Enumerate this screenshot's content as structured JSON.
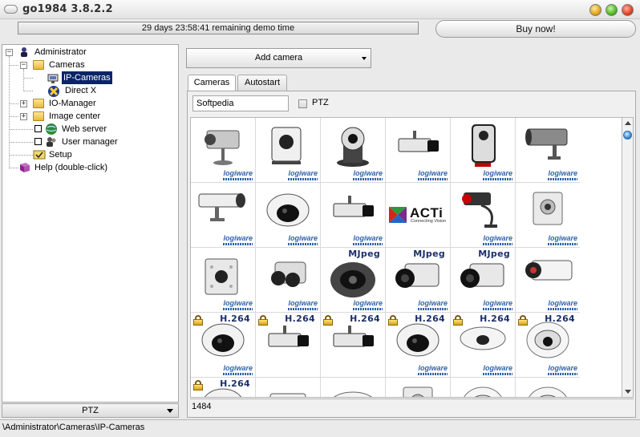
{
  "window": {
    "title": "go1984 3.8.2.2"
  },
  "demo_banner": {
    "text": "29 days 23:58:41 remaining demo time"
  },
  "buy_button": {
    "label": "Buy now!"
  },
  "tree": {
    "administrator": "Administrator",
    "cameras": "Cameras",
    "ip_cameras": "IP-Cameras",
    "direct_x": "Direct X",
    "io_manager": "IO-Manager",
    "image_center": "Image center",
    "web_server": "Web server",
    "user_manager": "User manager",
    "setup": "Setup",
    "help": "Help (double-click)"
  },
  "left_footer": {
    "label": "PTZ"
  },
  "status_bar": {
    "path": "\\Administrator\\Cameras\\IP-Cameras"
  },
  "toolbar": {
    "add_camera_label": "Add camera"
  },
  "tabs": [
    {
      "label": "Cameras"
    },
    {
      "label": "Autostart"
    }
  ],
  "filter": {
    "search_value": "Softpedia",
    "ptz_label": "PTZ"
  },
  "brand": {
    "logiware": "logiware",
    "mjpeg": "MJpeg",
    "h264": "H.264",
    "acti": "ACTi",
    "acti_sub": "Connecting Vision"
  },
  "camera_count": "1484",
  "colors": {
    "selection": "#0a246a",
    "brand_blue": "#2f63a8",
    "codec_navy": "#1c2f6b"
  }
}
